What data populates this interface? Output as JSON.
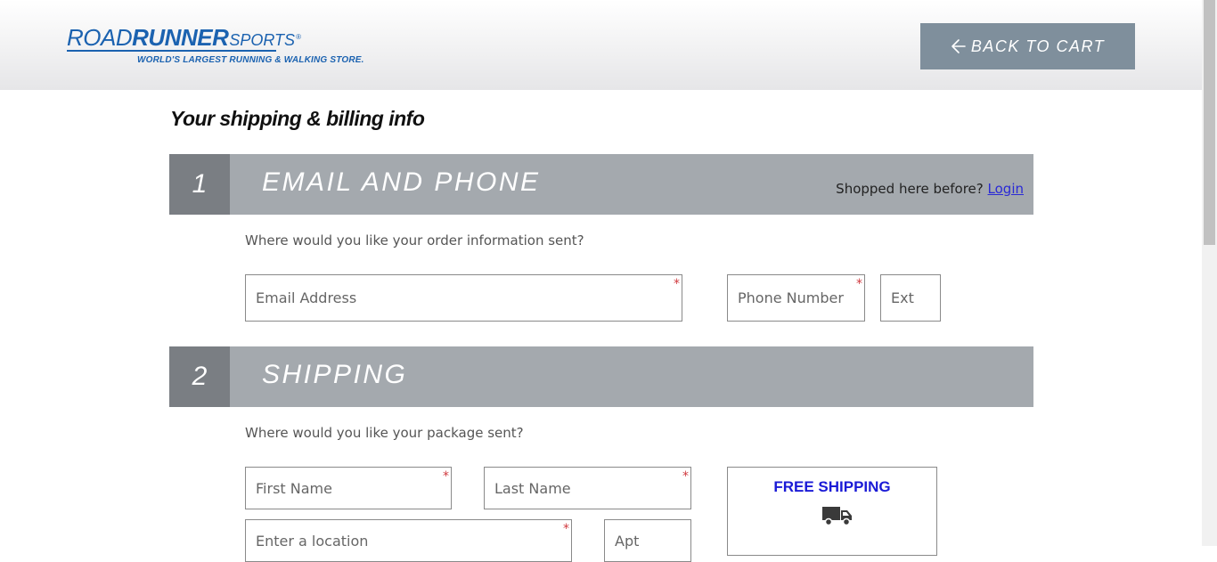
{
  "header": {
    "logo": {
      "road": "ROAD",
      "runner": "RUNNER",
      "sports": "SPORTS",
      "reg": "®",
      "tagline": "WORLD'S LARGEST RUNNING & WALKING STORE."
    },
    "back_button": {
      "label": "BACK TO CART",
      "icon": "arrow-left-icon"
    }
  },
  "page": {
    "title": "Your shipping & billing info"
  },
  "sections": [
    {
      "number": "1",
      "title": "EMAIL AND PHONE",
      "login_prompt": "Shopped here before?",
      "login_link": "Login",
      "prompt": "Where would you like your order information sent?",
      "fields": {
        "email": {
          "placeholder": "Email Address",
          "value": "",
          "required": true
        },
        "phone": {
          "placeholder": "Phone Number",
          "value": "",
          "required": true
        },
        "ext": {
          "placeholder": "Ext",
          "value": "",
          "required": false
        }
      }
    },
    {
      "number": "2",
      "title": "SHIPPING",
      "prompt": "Where would you like your package sent?",
      "fields": {
        "first_name": {
          "placeholder": "First Name",
          "value": "",
          "required": true
        },
        "last_name": {
          "placeholder": "Last Name",
          "value": "",
          "required": true
        },
        "location": {
          "placeholder": "Enter a location",
          "value": "",
          "required": true
        },
        "apt": {
          "placeholder": "Apt",
          "value": "",
          "required": false
        }
      },
      "shipping_option": {
        "label": "FREE SHIPPING",
        "icon": "truck-icon"
      }
    }
  ],
  "required_marker": "*",
  "colors": {
    "brand_blue": "#1b62b0",
    "button_gray": "#7f8f9c",
    "section_bar": "#a4a9ae",
    "section_number": "#7a7e83",
    "required_red": "#d0393e",
    "free_shipping_blue": "#1a1ad6"
  }
}
